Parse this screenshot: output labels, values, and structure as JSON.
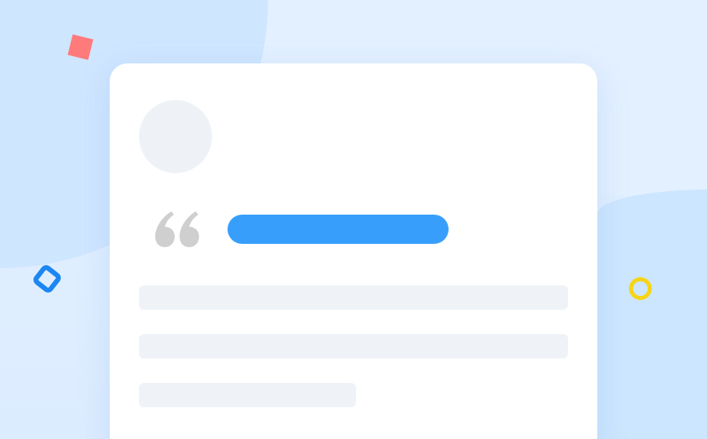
{
  "card": {
    "avatar": "avatar-placeholder",
    "quote_icon": "quote-open-icon",
    "title_placeholder": "skeleton-title",
    "text_lines": [
      "skeleton-line",
      "skeleton-line",
      "skeleton-line"
    ]
  },
  "colors": {
    "background": "#e4f1ff",
    "card": "#ffffff",
    "accent_bar": "#379ffb",
    "skeleton": "#eff3f7",
    "quote_icon": "#cfcfcf",
    "shape_red": "#ff7b7b",
    "shape_blue": "#1c86f2",
    "shape_yellow": "#f7d417"
  },
  "decorations": [
    "square-shape",
    "diamond-outline-shape",
    "ring-shape"
  ]
}
